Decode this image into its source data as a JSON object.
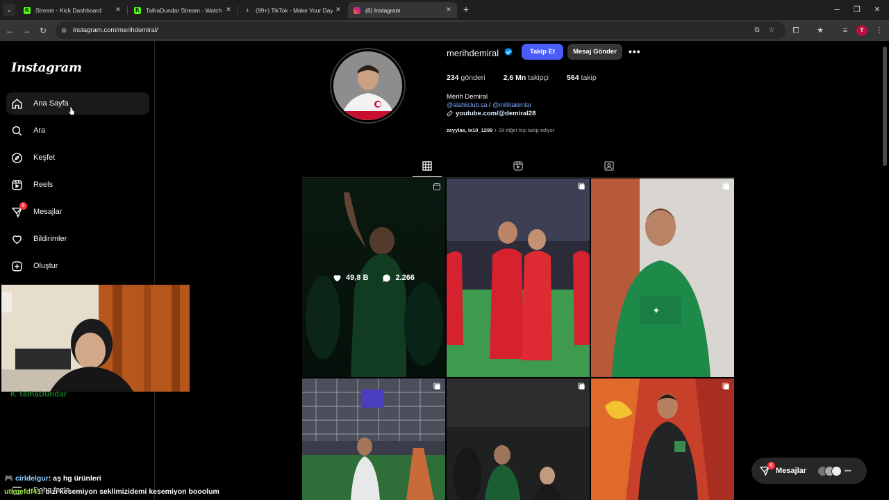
{
  "browser": {
    "tabs": [
      {
        "title": "Stream - Kick Dashboard",
        "favicon": "kick-icon",
        "color": "#53fc18"
      },
      {
        "title": "TalhaDundar Stream - Watch Live",
        "favicon": "kick-icon",
        "color": "#53fc18"
      },
      {
        "title": "(99+) TikTok - Make Your Day",
        "favicon": "tiktok-icon",
        "color": "#ffffff"
      },
      {
        "title": "(6) Instagram",
        "favicon": "instagram-icon",
        "color": "#e1306c"
      }
    ],
    "url": "instagram.com/merihdemiral/",
    "profile_initial": "T"
  },
  "sidebar": {
    "logo": "Instagram",
    "items": [
      {
        "label": "Ana Sayfa",
        "icon": "home-icon"
      },
      {
        "label": "Ara",
        "icon": "search-icon"
      },
      {
        "label": "Keşfet",
        "icon": "compass-icon"
      },
      {
        "label": "Reels",
        "icon": "reels-icon"
      },
      {
        "label": "Mesajlar",
        "icon": "messenger-icon",
        "badge": "6"
      },
      {
        "label": "Bildirimler",
        "icon": "heart-icon"
      },
      {
        "label": "Oluştur",
        "icon": "plus-square-icon"
      }
    ],
    "more": "Daha fazla"
  },
  "overlay": {
    "watermark": "TalhaDundar",
    "chat": [
      {
        "user": "cirldelgur",
        "text": ": aş hg ürünleri"
      },
      {
        "user": "utkuefdf41",
        "text": ": bizi kesemiyon seklimizidemi kesemiyon booolum"
      }
    ]
  },
  "profile": {
    "username": "merihdemiral",
    "follow_btn": "Takip Et",
    "message_btn": "Mesaj Gönder",
    "stats": [
      {
        "value": "234",
        "label": "gönderi"
      },
      {
        "value": "2,6 Mn",
        "label": "takipçi"
      },
      {
        "value": "564",
        "label": "takip"
      }
    ],
    "full_name": "Merih Demiral",
    "bio_link_1": "@alahliclub.sa",
    "bio_sep": " / ",
    "bio_link_2": "@millitakimlar",
    "external_link": "youtube.com/@demiral28",
    "followed_by_names": "zeyylas, ix10_1299",
    "followed_by_rest": " + 28 diğer kişi takip ediyor"
  },
  "grid": {
    "hover_likes": "49,8 B",
    "hover_comments": "2.266"
  },
  "messages_pill": {
    "label": "Mesajlar",
    "badge": "6"
  }
}
